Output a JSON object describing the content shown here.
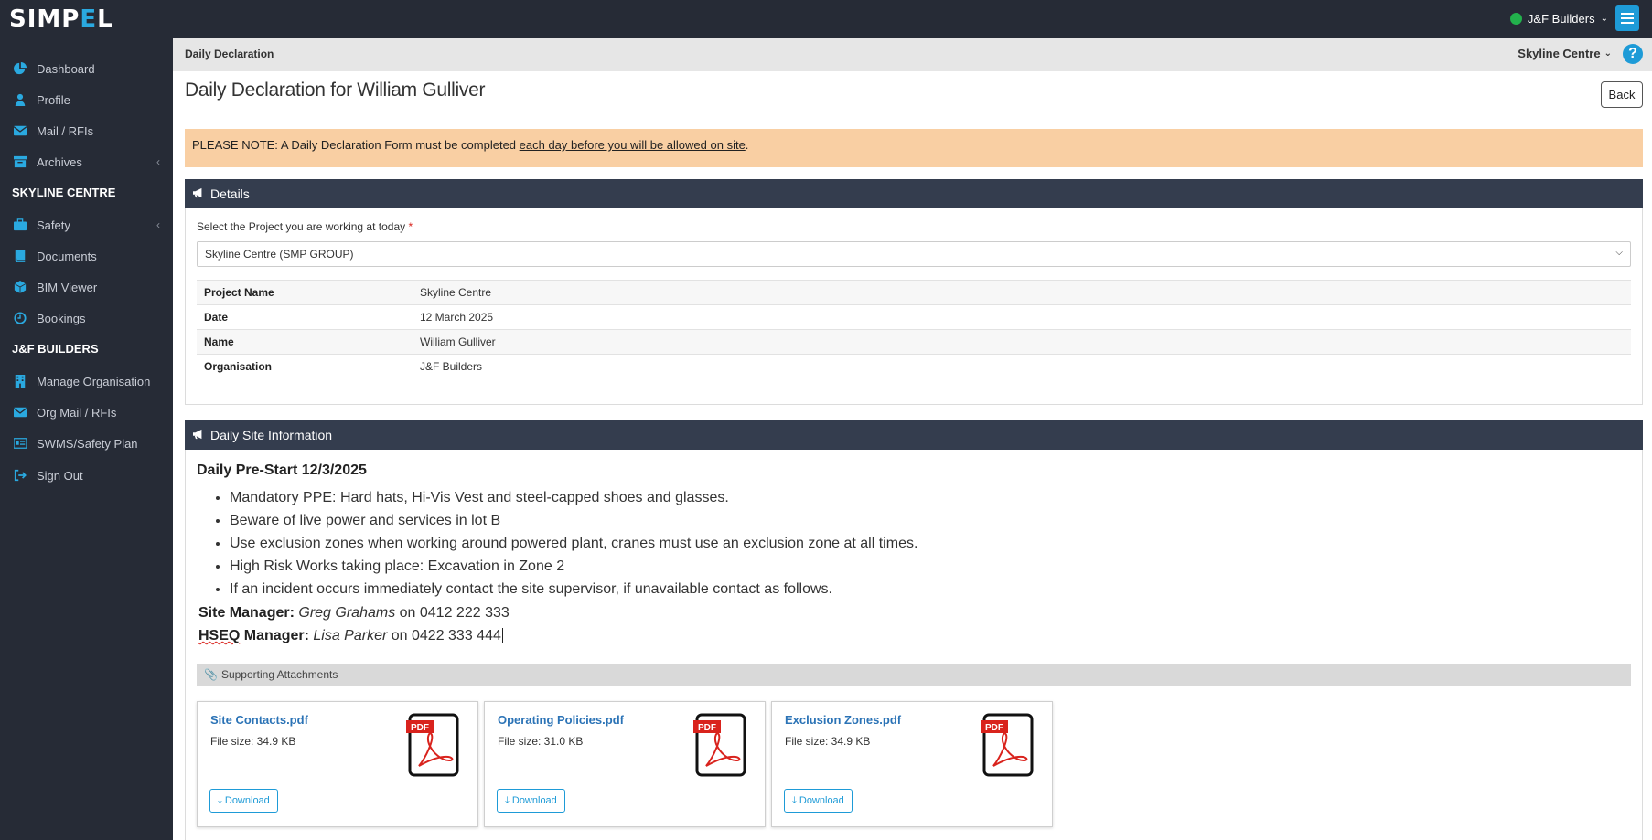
{
  "app": {
    "logo_pre": "SIMP",
    "logo_e": "E",
    "logo_post": "L"
  },
  "topbar": {
    "org": "J&F Builders",
    "status_color": "#22b14c"
  },
  "sidebar": {
    "items": [
      {
        "label": "Dashboard",
        "icon": "pie-chart-icon"
      },
      {
        "label": "Profile",
        "icon": "user-icon"
      },
      {
        "label": "Mail / RFIs",
        "icon": "envelope-icon"
      },
      {
        "label": "Archives",
        "icon": "archive-icon"
      },
      {
        "label": "Safety",
        "icon": "briefcase-icon"
      },
      {
        "label": "Documents",
        "icon": "book-icon"
      },
      {
        "label": "BIM Viewer",
        "icon": "cube-icon"
      },
      {
        "label": "Bookings",
        "icon": "clock-icon"
      },
      {
        "label": "Manage Organisation",
        "icon": "building-icon"
      },
      {
        "label": "Org Mail / RFIs",
        "icon": "envelope-icon"
      },
      {
        "label": "SWMS/Safety Plan",
        "icon": "id-card-icon"
      },
      {
        "label": "Sign Out",
        "icon": "sign-out-icon"
      }
    ],
    "sections": {
      "project": "SKYLINE CENTRE",
      "org": "J&F BUILDERS"
    }
  },
  "header": {
    "breadcrumb": "Daily Declaration",
    "site": "Skyline Centre"
  },
  "page": {
    "title": "Daily Declaration for William Gulliver",
    "back": "Back"
  },
  "notice": {
    "prefix": "PLEASE NOTE: A Daily Declaration Form must be completed ",
    "link": "each day before you will be allowed on site",
    "suffix": "."
  },
  "details": {
    "heading": "Details",
    "select_label": "Select the Project you are working at today",
    "required_mark": "*",
    "selected_project": "Skyline Centre (SMP GROUP)",
    "rows": [
      {
        "key": "Project Name",
        "value": "Skyline Centre"
      },
      {
        "key": "Date",
        "value": "12 March 2025"
      },
      {
        "key": "Name",
        "value": "William Gulliver"
      },
      {
        "key": "Organisation",
        "value": "J&F Builders"
      }
    ]
  },
  "site_info": {
    "heading": "Daily Site Information",
    "prestart_title": "Daily Pre-Start 12/3/2025",
    "bullets": [
      "Mandatory PPE: Hard hats, Hi-Vis Vest and steel-capped shoes and glasses.",
      "Beware of live power and services in lot B",
      "Use exclusion zones when working around powered plant, cranes must use an exclusion zone at all times.",
      "High Risk Works taking place: Excavation in Zone 2",
      "If an incident occurs immediately contact the site supervisor, if unavailable contact as follows."
    ],
    "site_manager": {
      "role": "Site Manager:",
      "name": "Greg Grahams",
      "phone": "on 0412 222 333"
    },
    "hseq_manager": {
      "role_a": "HSEQ",
      "role_b": " Manager:",
      "name": "Lisa Parker",
      "phone": "on 0422 333 444"
    },
    "attachments_label": "Supporting Attachments",
    "attachments": [
      {
        "name": "Site Contacts.pdf",
        "size": "File size: 34.9 KB",
        "download": "Download"
      },
      {
        "name": "Operating Policies.pdf",
        "size": "File size: 31.0 KB",
        "download": "Download"
      },
      {
        "name": "Exclusion Zones.pdf",
        "size": "File size: 34.9 KB",
        "download": "Download"
      }
    ],
    "pdf_badge": "PDF"
  }
}
